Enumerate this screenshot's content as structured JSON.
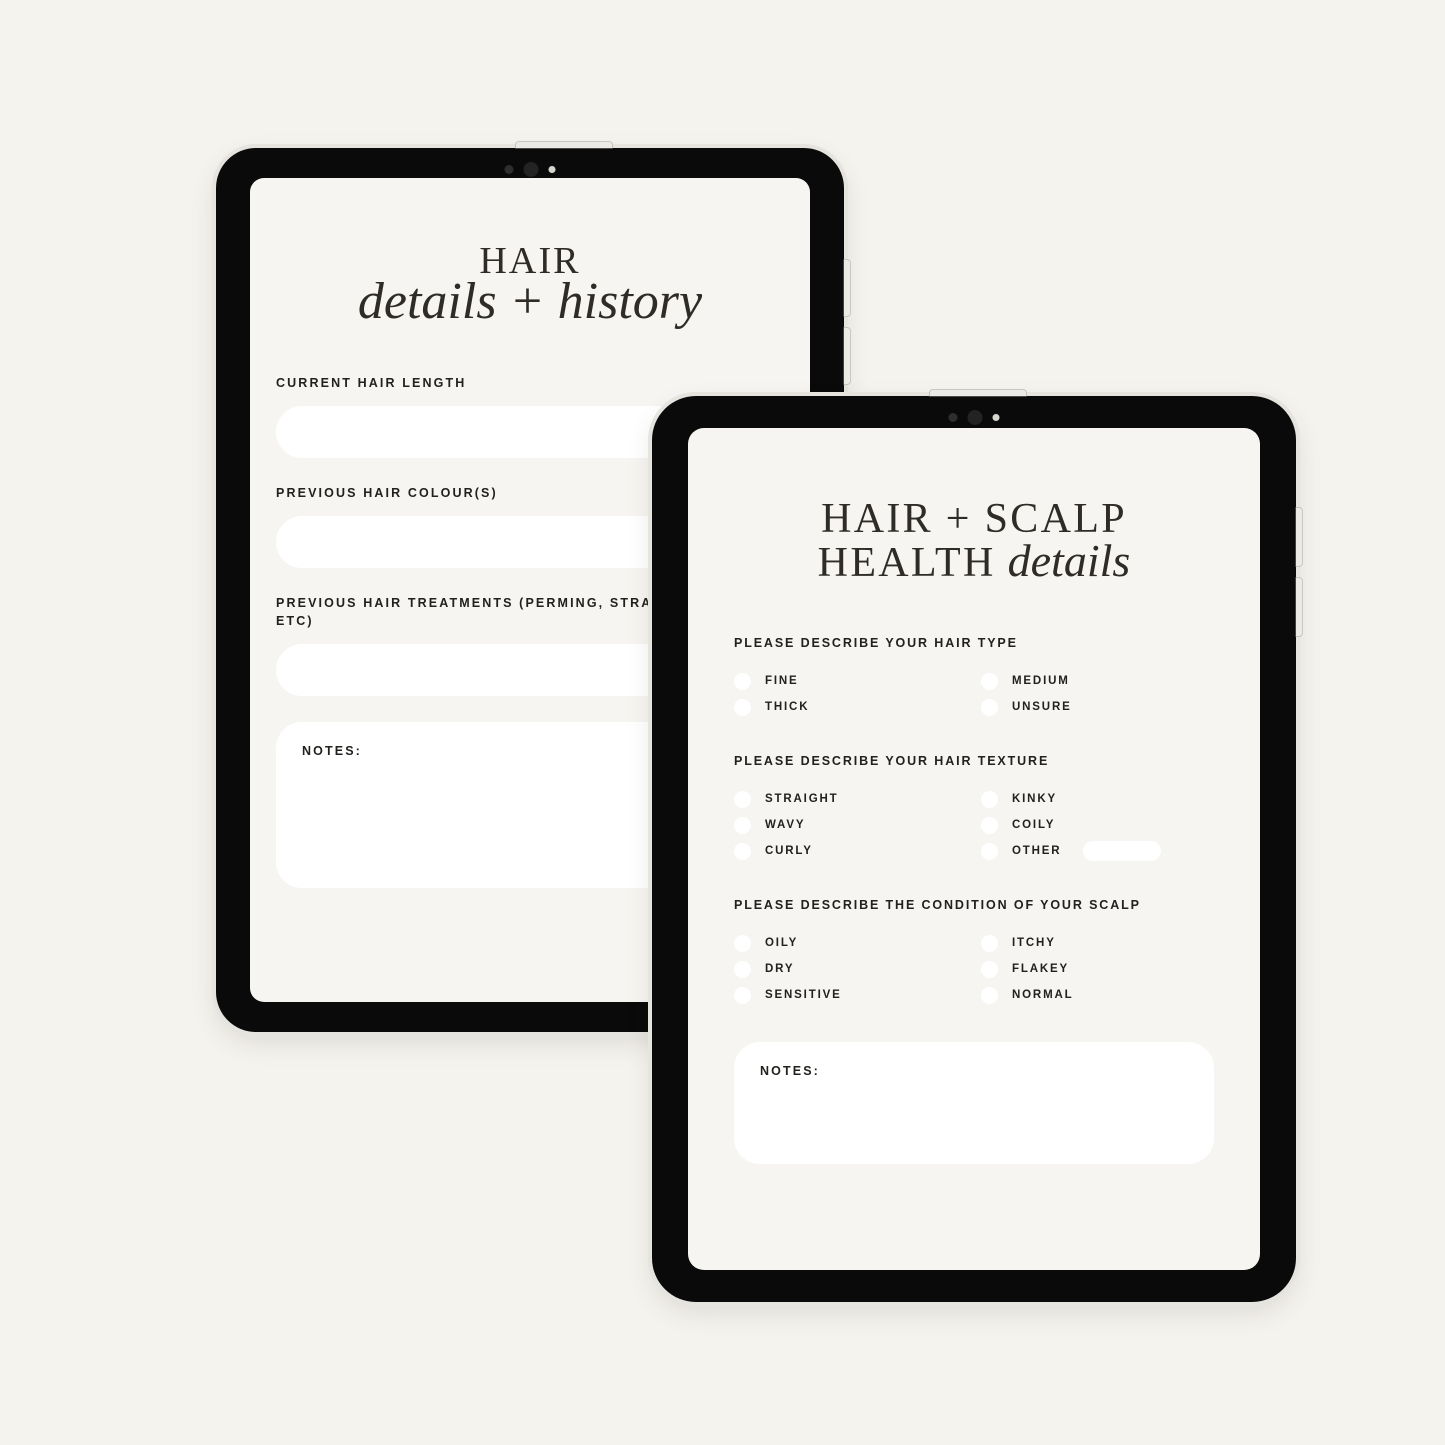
{
  "canvas": {
    "background_color": "#f5f3ee",
    "screen_color": "#f7f5f1",
    "ink_color": "#23211d"
  },
  "tablet_back": {
    "device_name": "tablet-back",
    "hardware": {
      "camera_small": "camera-dot",
      "camera_large": "camera-lens",
      "camera_sensor": "sensor-dot",
      "power_button": "power-button",
      "volume_up": "volume-up-button",
      "volume_down": "volume-down-button"
    },
    "page": {
      "title_caps": "HAIR",
      "title_italic": "details + history",
      "fields": [
        {
          "label": "CURRENT HAIR LENGTH",
          "value": ""
        },
        {
          "label": "PREVIOUS HAIR COLOUR(S)",
          "value": ""
        },
        {
          "label": "PREVIOUS HAIR TREATMENTS (PERMING, STRAIGHTENING ETC)",
          "value": ""
        }
      ],
      "notes_label": "NOTES:",
      "notes_value": ""
    }
  },
  "tablet_front": {
    "device_name": "tablet-front",
    "hardware": {
      "camera_small": "camera-dot",
      "camera_large": "camera-lens",
      "camera_sensor": "sensor-dot",
      "power_button": "power-button",
      "volume_up": "volume-up-button",
      "volume_down": "volume-down-button"
    },
    "page": {
      "title_line1_caps": "HAIR + SCALP",
      "title_line2_caps": "HEALTH",
      "title_line2_italic": "details",
      "sections": [
        {
          "heading": "PLEASE DESCRIBE YOUR HAIR TYPE",
          "left_options": [
            "FINE",
            "THICK"
          ],
          "right_options": [
            "MEDIUM",
            "UNSURE"
          ]
        },
        {
          "heading": "PLEASE DESCRIBE YOUR HAIR TEXTURE",
          "left_options": [
            "STRAIGHT",
            "WAVY",
            "CURLY"
          ],
          "right_options": [
            "KINKY",
            "COILY",
            "OTHER"
          ],
          "other_label": "OTHER",
          "other_value": ""
        },
        {
          "heading": "PLEASE DESCRIBE THE CONDITION OF YOUR SCALP",
          "left_options": [
            "OILY",
            "DRY",
            "SENSITIVE"
          ],
          "right_options": [
            "ITCHY",
            "FLAKEY",
            "NORMAL"
          ]
        }
      ],
      "notes_label": "NOTES:",
      "notes_value": ""
    }
  }
}
